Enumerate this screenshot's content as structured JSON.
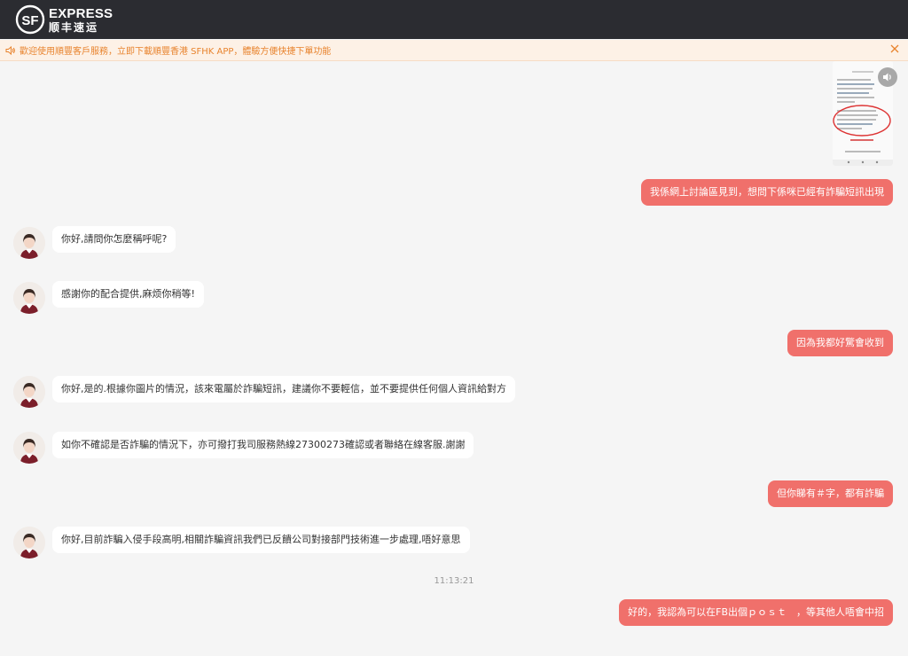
{
  "header": {
    "logo_mark": "SF",
    "logo_en": "EXPRESS",
    "logo_zh": "顺丰速运"
  },
  "notice": {
    "text": "歡迎使用順豐客戶服務，立即下載順豐香港 SFHK APP，體驗方便快捷下單功能",
    "icon": "speaker-icon",
    "close_icon": "close-icon"
  },
  "messages": [
    {
      "from": "user",
      "type": "image",
      "desc": "screenshot-thumbnail"
    },
    {
      "from": "user",
      "text": "我係網上討論區見到，想問下係咪已經有詐騙短訊出現"
    },
    {
      "from": "agent",
      "text": "你好,請問你怎麼稱呼呢?"
    },
    {
      "from": "agent",
      "text": "感謝你的配合提供,麻烦你稍等!"
    },
    {
      "from": "user",
      "text": "因為我都好驚會收到"
    },
    {
      "from": "agent",
      "text": "你好,是的.根據你圖片的情況，該來電屬於詐騙短訊，建議你不要輕信，並不要提供任何個人資訊給對方"
    },
    {
      "from": "agent",
      "text": "如你不確認是否詐騙的情況下，亦可撥打我司服務熱線27300273確認或者聯絡在線客服.謝謝"
    },
    {
      "from": "user",
      "text": "但你睇有＃字，都有詐騙"
    },
    {
      "from": "agent",
      "text": "你好,目前詐騙入侵手段高明,相關詐騙資訊我們已反饋公司對接部門技術進一步處理,唔好意思"
    },
    {
      "from": "system",
      "text": "11:13:21"
    },
    {
      "from": "user",
      "text": "好的，我認為可以在FB出個ｐｏｓｔ　，等其他人唔會中招"
    }
  ],
  "colors": {
    "header_bg": "#2b2c31",
    "user_bubble": "#f0706b",
    "notice_text": "#e8832d",
    "notice_bg": "#fdf1e6"
  }
}
